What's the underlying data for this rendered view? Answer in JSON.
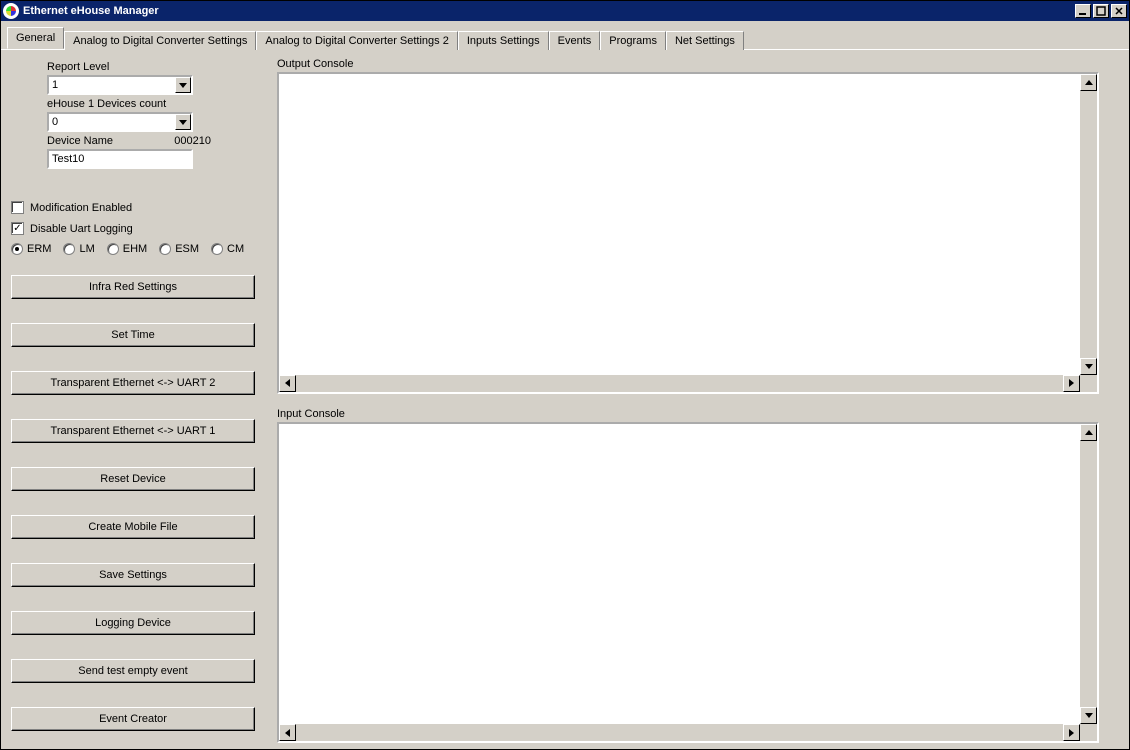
{
  "window": {
    "title": "Ethernet eHouse Manager"
  },
  "tabs": [
    {
      "label": "General",
      "active": true
    },
    {
      "label": "Analog to Digital Converter Settings",
      "active": false
    },
    {
      "label": "Analog to Digital Converter Settings 2",
      "active": false
    },
    {
      "label": "Inputs Settings",
      "active": false
    },
    {
      "label": "Events",
      "active": false
    },
    {
      "label": "Programs",
      "active": false
    },
    {
      "label": "Net Settings",
      "active": false
    }
  ],
  "left": {
    "report_level_label": "Report Level",
    "report_level_value": "1",
    "devices_count_label": "eHouse 1 Devices count",
    "devices_count_value": "0",
    "device_name_label": "Device Name",
    "device_code": "000210",
    "device_name_value": "Test10"
  },
  "checks": {
    "modification_enabled_label": "Modification Enabled",
    "modification_enabled_checked": false,
    "disable_uart_label": "Disable Uart Logging",
    "disable_uart_checked": true
  },
  "radios": [
    {
      "label": "ERM",
      "checked": true
    },
    {
      "label": "LM",
      "checked": false
    },
    {
      "label": "EHM",
      "checked": false
    },
    {
      "label": "ESM",
      "checked": false
    },
    {
      "label": "CM",
      "checked": false
    }
  ],
  "buttons": [
    "Infra Red Settings",
    "Set Time",
    "Transparent Ethernet <-> UART 2",
    "Transparent Ethernet <-> UART 1",
    "Reset Device",
    "Create Mobile File",
    "Save Settings",
    "Logging Device",
    "Send test empty event",
    "Event Creator"
  ],
  "right": {
    "output_label": "Output Console",
    "output_text": "",
    "input_label": "Input Console",
    "input_text": ""
  }
}
